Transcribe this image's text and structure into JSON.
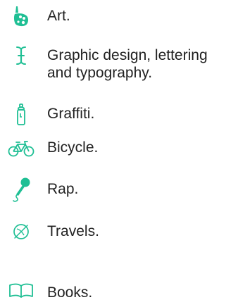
{
  "theme": {
    "accent": "#1fbf94",
    "text": "#222222",
    "background": "#ffffff"
  },
  "interests": [
    {
      "label": "Art.",
      "icon": "palette-icon"
    },
    {
      "label": "Graphic design, lettering and typography.",
      "icon": "text-cursor-icon"
    },
    {
      "label": "Graffiti.",
      "icon": "spray-can-icon"
    },
    {
      "label": "Bicycle.",
      "icon": "bicycle-icon"
    },
    {
      "label": "Rap.",
      "icon": "microphone-icon"
    },
    {
      "label": "Travels.",
      "icon": "globe-icon"
    },
    {
      "label": "Books.",
      "icon": "book-icon"
    }
  ]
}
